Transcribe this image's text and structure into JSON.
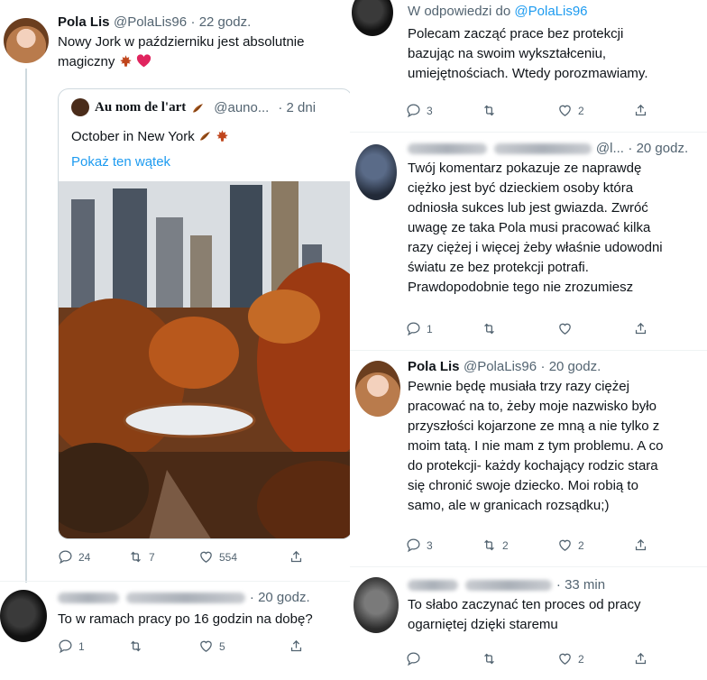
{
  "left": {
    "post1": {
      "name": "Pola Lis",
      "handle": "@PolaLis96",
      "time": "· 22 godz.",
      "text_line1": "Nowy Jork w październiku jest absolutnie",
      "text_line2": "magiczny",
      "quote": {
        "name": "Au nom de l'art",
        "handle": "@auno...",
        "time": "· 2 dni",
        "text": "October in New York",
        "show_thread": "Pokaż ten wątek"
      },
      "actions": {
        "replies": "24",
        "retweets": "7",
        "likes": "554"
      }
    },
    "post2": {
      "time": "· 20 godz.",
      "text": "To w ramach pracy po 16 godzin na dobę?",
      "actions": {
        "replies": "1",
        "retweets": "",
        "likes": "5"
      }
    }
  },
  "right": {
    "post1": {
      "reply_to_prefix": "W odpowiedzi do",
      "reply_to_handle": "@PolaLis96",
      "lines": [
        "Polecam zacząć prace bez protekcji",
        "bazując na swoim wykształceniu,",
        "umiejętnościach. Wtedy porozmawiamy."
      ],
      "actions": {
        "replies": "3",
        "retweets": "",
        "likes": "2"
      }
    },
    "post2": {
      "handle_tail": "@l...",
      "time": "· 20 godz.",
      "lines": [
        "Twój komentarz pokazuje ze naprawdę",
        "ciężko jest być dzieckiem osoby która",
        "odniosła sukces lub jest gwiazda. Zwróć",
        "uwagę ze taka Pola musi pracować kilka",
        "razy ciężej i więcej żeby właśnie udowodni",
        "światu ze bez protekcji potrafi.",
        "Prawdopodobnie tego nie zrozumiesz"
      ],
      "actions": {
        "replies": "1",
        "retweets": "",
        "likes": ""
      }
    },
    "post3": {
      "name": "Pola Lis",
      "handle": "@PolaLis96",
      "time": "· 20 godz.",
      "lines": [
        "Pewnie będę musiała trzy razy ciężej",
        "pracować na to, żeby moje nazwisko było",
        "przyszłości kojarzone ze mną a nie tylko z",
        "moim tatą. I nie mam z tym problemu. A co",
        "do protekcji- każdy kochający rodzic stara",
        "się chronić swoje dziecko. Moi robią to",
        "samo, ale w granicach rozsądku;)"
      ],
      "actions": {
        "replies": "3",
        "retweets": "2",
        "likes": "2"
      }
    },
    "post4": {
      "time": "· 33 min",
      "lines": [
        "To słabo zaczynać ten proces od pracy",
        "ogarniętej dzięki staremu"
      ],
      "actions": {
        "replies": "",
        "retweets": "",
        "likes": "2"
      }
    }
  },
  "colors": {
    "link": "#1d9bf0",
    "muted": "#536471",
    "text": "#0f1419"
  },
  "icons": [
    "reply-icon",
    "retweet-icon",
    "like-icon",
    "share-icon",
    "maple-leaf-icon",
    "heart-icon"
  ]
}
